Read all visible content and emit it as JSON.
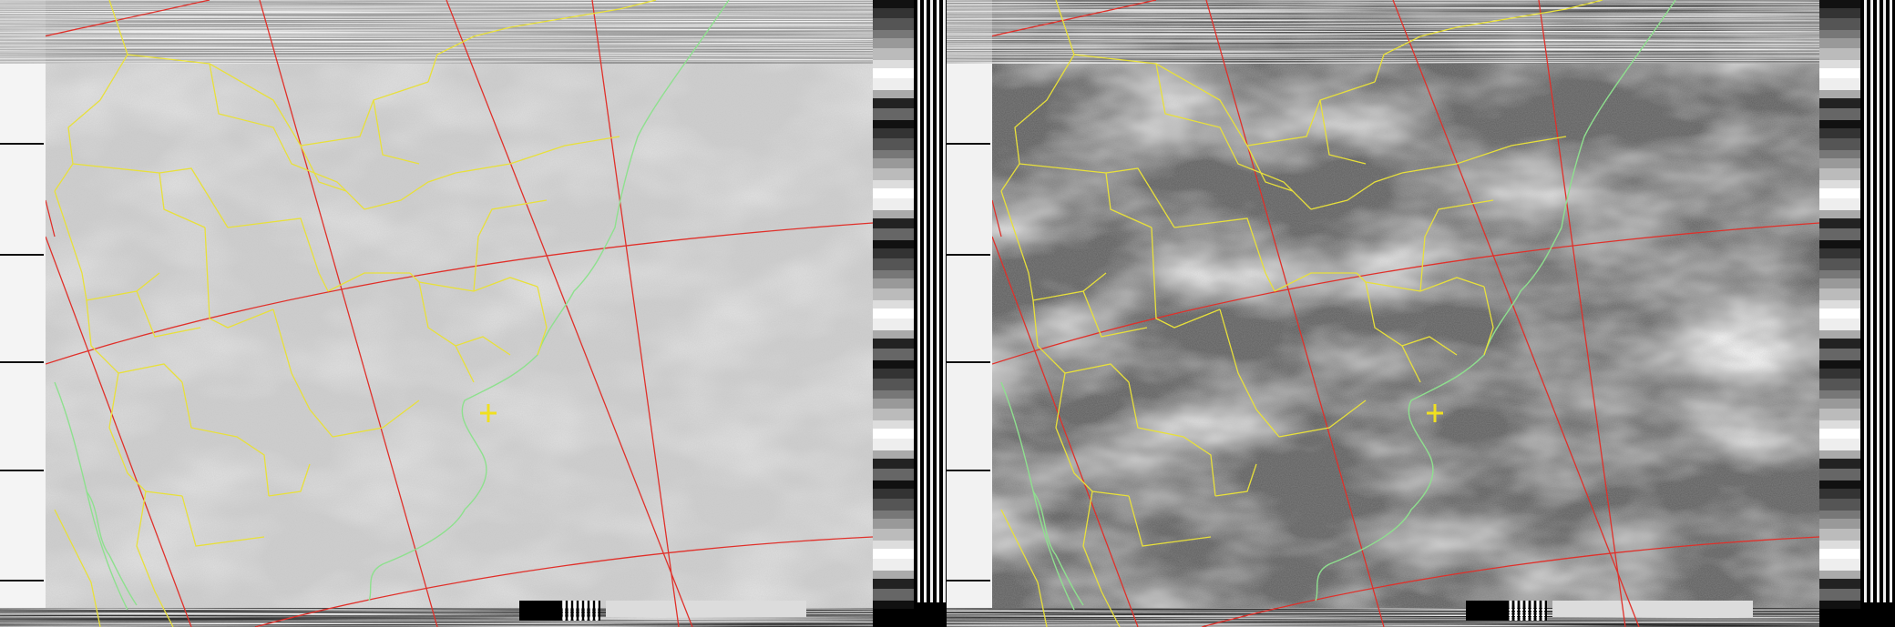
{
  "image": {
    "kind": "NOAA APT weather satellite image (dual channel) with map overlay",
    "channels": [
      {
        "name": "channel-a",
        "tone": "light-gray"
      },
      {
        "name": "channel-b",
        "tone": "dark-gray-with-clouds"
      }
    ]
  },
  "overlay_colors": {
    "political_borders": "#e8e03a",
    "coastline": "#8ee08e",
    "graticule": "#e0302a",
    "station_marker": "#f0e020"
  },
  "marker": {
    "shape": "plus"
  }
}
